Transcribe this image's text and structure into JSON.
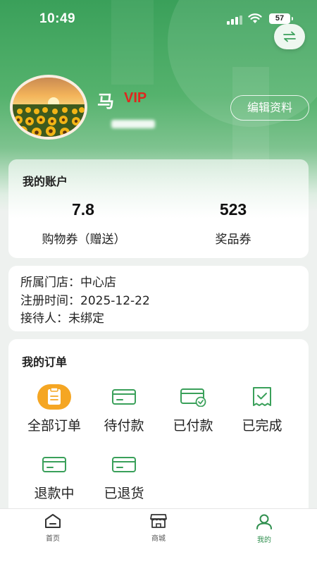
{
  "status_bar": {
    "time": "10:49",
    "battery": "57"
  },
  "profile": {
    "name": "马",
    "vip_label": "VIP",
    "edit_button": "编辑资料",
    "avatar_icon": "sunflower-field-photo"
  },
  "account": {
    "title": "我的账户",
    "items": [
      {
        "value": "7.8",
        "label": "购物券（赠送）"
      },
      {
        "value": "523",
        "label": "奖品券"
      }
    ]
  },
  "info": {
    "store_label": "所属门店：",
    "store_value": "中心店",
    "register_label": "注册时间：",
    "register_value": "2025-12-22",
    "host_label": "接待人：",
    "host_value": "未绑定"
  },
  "orders": {
    "title": "我的订单",
    "items": [
      {
        "label": "全部订单",
        "icon": "clipboard-icon"
      },
      {
        "label": "待付款",
        "icon": "card-icon"
      },
      {
        "label": "已付款",
        "icon": "card-check-icon"
      },
      {
        "label": "已完成",
        "icon": "receipt-check-icon"
      },
      {
        "label": "退款中",
        "icon": "card-icon"
      },
      {
        "label": "已退货",
        "icon": "card-icon"
      }
    ]
  },
  "tabs": [
    {
      "label": "首页",
      "icon": "home-icon"
    },
    {
      "label": "商城",
      "icon": "store-icon"
    },
    {
      "label": "我的",
      "icon": "user-icon",
      "active": true
    }
  ],
  "colors": {
    "primary": "#3aa05a",
    "vip": "#e0261d",
    "accent_orange": "#f5a623"
  }
}
